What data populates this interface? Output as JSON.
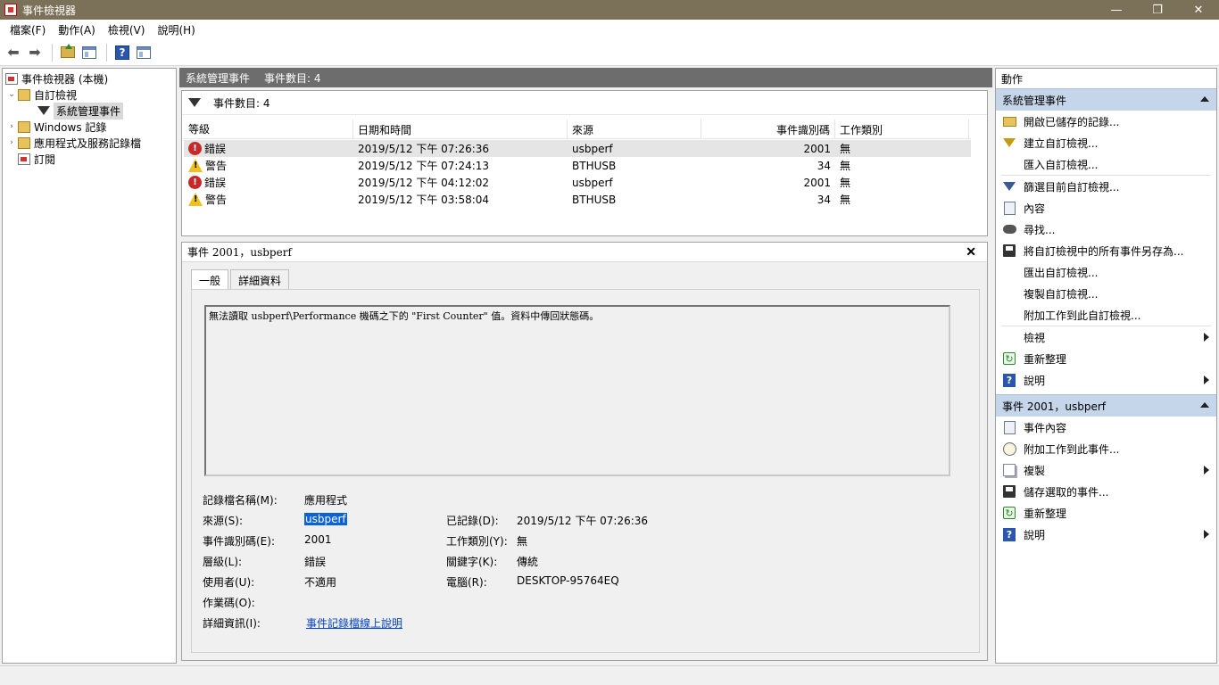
{
  "window": {
    "title": "事件檢視器",
    "controls": {
      "minimize": "—",
      "maximize": "❐",
      "close": "✕"
    }
  },
  "menu": [
    "檔案(F)",
    "動作(A)",
    "檢視(V)",
    "說明(H)"
  ],
  "toolbar": {
    "back_icon": "back-arrow-icon",
    "forward_icon": "forward-arrow-icon",
    "help_glyph": "?"
  },
  "tree": {
    "root": "事件檢視器 (本機)",
    "custom_views": "自訂檢視",
    "admin_events": "系統管理事件",
    "windows_logs": "Windows 記錄",
    "app_service_logs": "應用程式及服務記錄檔",
    "subscriptions": "訂閱"
  },
  "center": {
    "header_title": "系統管理事件",
    "header_count": "事件數目: 4",
    "filter_count": "事件數目: 4",
    "columns": [
      "等級",
      "日期和時間",
      "來源",
      "事件識別碼",
      "工作類別"
    ],
    "rows": [
      {
        "level": "錯誤",
        "level_type": "error",
        "datetime": "2019/5/12 下午 07:26:36",
        "source": "usbperf",
        "event_id": "2001",
        "task": "無"
      },
      {
        "level": "警告",
        "level_type": "warning",
        "datetime": "2019/5/12 下午 07:24:13",
        "source": "BTHUSB",
        "event_id": "34",
        "task": "無"
      },
      {
        "level": "錯誤",
        "level_type": "error",
        "datetime": "2019/5/12 下午 04:12:02",
        "source": "usbperf",
        "event_id": "2001",
        "task": "無"
      },
      {
        "level": "警告",
        "level_type": "warning",
        "datetime": "2019/5/12 下午 03:58:04",
        "source": "BTHUSB",
        "event_id": "34",
        "task": "無"
      }
    ]
  },
  "detail": {
    "title": "事件 2001，usbperf",
    "close": "✕",
    "tabs": [
      "一般",
      "詳細資料"
    ],
    "description": "無法讀取 usbperf\\Performance 機碼之下的 \"First Counter\" 值。資料中傳回狀態碼。",
    "labels": {
      "log_name": "記錄檔名稱(M):",
      "source": "來源(S):",
      "event_id": "事件識別碼(E):",
      "level": "層級(L):",
      "user": "使用者(U):",
      "opcode": "作業碼(O):",
      "more_info": "詳細資訊(I):",
      "logged": "已記錄(D):",
      "task": "工作類別(Y):",
      "keywords": "關鍵字(K):",
      "computer": "電腦(R):"
    },
    "values": {
      "log_name": "應用程式",
      "source": "usbperf",
      "event_id": "2001",
      "level": "錯誤",
      "user": "不適用",
      "opcode": "",
      "more_info": "事件記錄檔線上說明",
      "logged": "2019/5/12 下午 07:26:36",
      "task": "無",
      "keywords": "傳統",
      "computer": "DESKTOP-95764EQ"
    }
  },
  "actions": {
    "title": "動作",
    "section1": "系統管理事件",
    "section1_items": {
      "open_saved": "開啟已儲存的記錄...",
      "create_custom": "建立自訂檢視...",
      "import_custom": "匯入自訂檢視...",
      "filter_current": "篩選目前自訂檢視...",
      "properties": "內容",
      "find": "尋找...",
      "save_all": "將自訂檢視中的所有事件另存為...",
      "export_custom": "匯出自訂檢視...",
      "copy_custom": "複製自訂檢視...",
      "attach_task": "附加工作到此自訂檢視...",
      "view": "檢視",
      "refresh": "重新整理",
      "help": "說明"
    },
    "section2": "事件 2001，usbperf",
    "section2_items": {
      "event_props": "事件內容",
      "attach_event_task": "附加工作到此事件...",
      "copy": "複製",
      "save_selected": "儲存選取的事件...",
      "refresh": "重新整理",
      "help": "說明"
    }
  },
  "colors": {
    "titlebar": "#7b7158",
    "section_header": "#c5d6ea",
    "center_header": "#6d6d6d",
    "link": "#0645c0",
    "selection": "#0b62d6"
  }
}
